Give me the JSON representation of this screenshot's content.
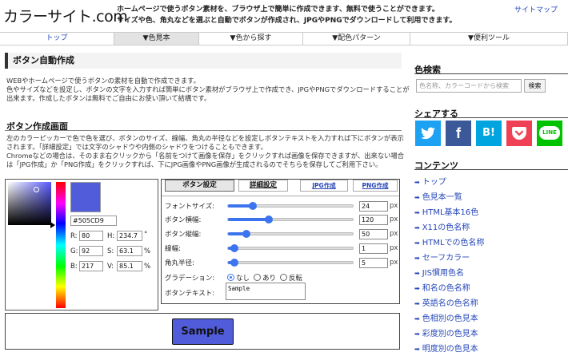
{
  "site": {
    "logo": "カラーサイト.com",
    "tagline1": "ホームページで使うボタン素材を、ブラウザ上で簡単に作成できます、無料で使うことができます。",
    "tagline2": "サイズや色、角丸などを選ぶと自動でボタンが作成され、JPGやPNGでダウンロードして利用できます。",
    "sitemap": "サイトマップ"
  },
  "nav": {
    "items": [
      "トップ",
      "▼色見本",
      "▼色から探す",
      "▼配色パターン",
      "▼便利ツール"
    ]
  },
  "intro": {
    "title": "ボタン自動作成",
    "lines": [
      "WEBやホームページで使うボタンの素材を自動で作成できます。",
      "色やサイズなどを設定し、ボタンの文字を入力すれば簡単にボタン素材がブラウザ上で作成でき、JPGやPNGでダウンロードすることが",
      "出来ます。作成したボタンは無料でご自由にお使い頂いて結構です。"
    ]
  },
  "screen": {
    "title": "ボタン作成画面",
    "lines": [
      "左のカラーピッカーで色で色を選び、ボタンのサイズ、線幅、角丸の半径などを設定しボタンテキストを入力すれば下にボタンが表示",
      "されます。「詳細設定」では文字のシャドウや内側のシャドウをつけることもできます。",
      "Chromeなどの場合は、そのまま右クリックから「名前をつけて画像を保存」をクリックすれば画像を保存できますが、出来ない場合",
      "は「JPG作成」か「PNG作成」をクリックすれば、下にJPG画像やPNG画像が生成されるのでそちらを保存してご利用下さい。"
    ]
  },
  "picker": {
    "hex": "#505CD9",
    "r_label": "R:",
    "r": "80",
    "g_label": "G:",
    "g": "92",
    "b_label": "B:",
    "b": "217",
    "h_label": "H:",
    "h": "234.7",
    "h_unit": "°",
    "s_label": "S:",
    "s": "63.1",
    "s_unit": "%",
    "v_label": "V:",
    "v": "85.1",
    "v_unit": "%",
    "color": "#505CD9"
  },
  "tabs": {
    "settings": "ボタン設定",
    "advanced": "詳細設定",
    "jpg": "JPG作成",
    "png": "PNG作成"
  },
  "settings": {
    "font_size": {
      "label": "フォントサイズ:",
      "value": "24",
      "unit": "px",
      "level": 0.2
    },
    "width": {
      "label": "ボタン横幅:",
      "value": "120",
      "unit": "px",
      "level": 0.33
    },
    "height": {
      "label": "ボタン縦幅:",
      "value": "50",
      "unit": "px",
      "level": 0.15
    },
    "border": {
      "label": "線幅:",
      "value": "1",
      "unit": "px",
      "level": 0.05
    },
    "radius": {
      "label": "角丸半径:",
      "value": "5",
      "unit": "px",
      "level": 0.05
    },
    "gradation": {
      "label": "グラデーション:",
      "options": [
        "なし",
        "あり",
        "反転"
      ],
      "selected": "なし"
    },
    "text": {
      "label": "ボタンテキスト:",
      "value": "Sample"
    }
  },
  "preview": {
    "button_text": "Sample",
    "button_color": "#505CD9"
  },
  "sidebar": {
    "color_search": {
      "title": "色検索",
      "placeholder": "色名称、カラーコードから検索",
      "button": "検索"
    },
    "share": {
      "title": "シェアする",
      "buttons": [
        {
          "name": "twitter",
          "glyph": "🐦",
          "color": "#1da1f2"
        },
        {
          "name": "facebook",
          "glyph": "f",
          "color": "#3b5998"
        },
        {
          "name": "hatena",
          "glyph": "B!",
          "color": "#00a4de"
        },
        {
          "name": "pocket",
          "glyph": "◗",
          "color": "#ef4056"
        },
        {
          "name": "line",
          "glyph": "LINE",
          "color": "#00c300"
        }
      ]
    },
    "contents": {
      "title": "コンテンツ",
      "items": [
        "トップ",
        "色見本一覧",
        "HTML基本16色",
        "X11の色名称",
        "HTMLでの色名称",
        "セーフカラー",
        "JIS慣用色名",
        "和名の色名称",
        "英語名の色名称",
        "色相別の色見本",
        "彩度別の色見本",
        "明度別の色見本"
      ]
    }
  }
}
